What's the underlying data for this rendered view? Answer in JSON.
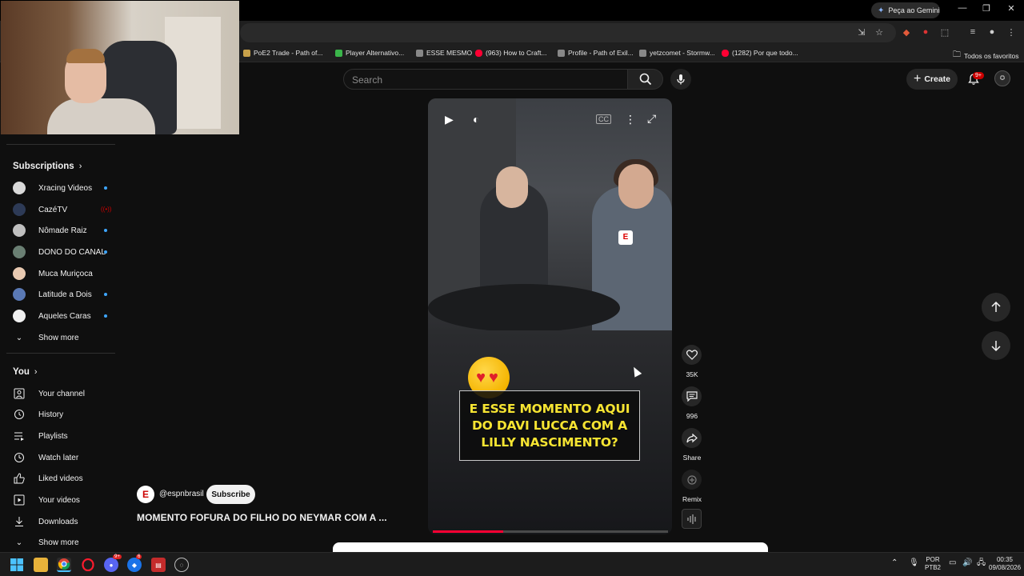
{
  "browser": {
    "gemini_label": "Peça ao Gemini",
    "bookmarks": [
      {
        "label": "PoE2 Trade - Path of...",
        "color": "#c8a14a"
      },
      {
        "label": "Player Alternativo...",
        "color": "#3ab54a"
      },
      {
        "label": "ESSE MESMO",
        "color": "#888888"
      },
      {
        "label": "(963) How to Craft...",
        "color": "#ff0033"
      },
      {
        "label": "Profile - Path of Exil...",
        "color": "#888888"
      },
      {
        "label": "yetzcomet - Stormw...",
        "color": "#888888"
      },
      {
        "label": "(1282) Por que todo...",
        "color": "#ff0033"
      }
    ],
    "all_bookmarks_label": "Todos os favoritos"
  },
  "header": {
    "search_placeholder": "Search",
    "create_label": "Create",
    "notifications_badge": "9+"
  },
  "sidebar": {
    "subscriptions_title": "Subscriptions",
    "subscriptions": [
      {
        "label": "Xracing Videos",
        "status": "new",
        "avatar_color": "#d9d9d9"
      },
      {
        "label": "CazéTV",
        "status": "live",
        "avatar_color": "#2d3a56"
      },
      {
        "label": "Nômade Raiz",
        "status": "new",
        "avatar_color": "#bfbfbf"
      },
      {
        "label": "DONO DO CANAL",
        "status": "new",
        "avatar_color": "#6a7f73"
      },
      {
        "label": "Muca Muriçoca",
        "status": "none",
        "avatar_color": "#e8c9b1"
      },
      {
        "label": "Latitude a Dois",
        "status": "new",
        "avatar_color": "#5a79b5"
      },
      {
        "label": "Aqueles Caras",
        "status": "new",
        "avatar_color": "#f0f0f0"
      }
    ],
    "show_more_label": "Show more",
    "you_title": "You",
    "you_items": [
      {
        "label": "Your channel",
        "icon": "person-square-icon"
      },
      {
        "label": "History",
        "icon": "history-icon"
      },
      {
        "label": "Playlists",
        "icon": "playlists-icon"
      },
      {
        "label": "Watch later",
        "icon": "clock-icon"
      },
      {
        "label": "Liked videos",
        "icon": "thumbs-up-icon"
      },
      {
        "label": "Your videos",
        "icon": "play-square-icon"
      },
      {
        "label": "Downloads",
        "icon": "download-icon"
      }
    ],
    "show_more_label_2": "Show more"
  },
  "short": {
    "caption_lines": [
      "E ESSE MOMENTO AQUI",
      "DO DAVI LUCCA COM A",
      "LILLY NASCIMENTO?"
    ],
    "channel_handle": "@espnbrasil",
    "subscribe_label": "Subscribe",
    "title": "MOMENTO FOFURA DO FILHO DO NEYMAR COM A ...",
    "progress": 0.3,
    "progress_color": "#ff0033"
  },
  "actions": {
    "likes": "35K",
    "comments": "996",
    "share": "Share",
    "remix": "Remix"
  },
  "taskbar": {
    "lang_line1": "POR",
    "lang_line2": "PTB2",
    "time": "00:35",
    "date": "09/08/2026"
  }
}
